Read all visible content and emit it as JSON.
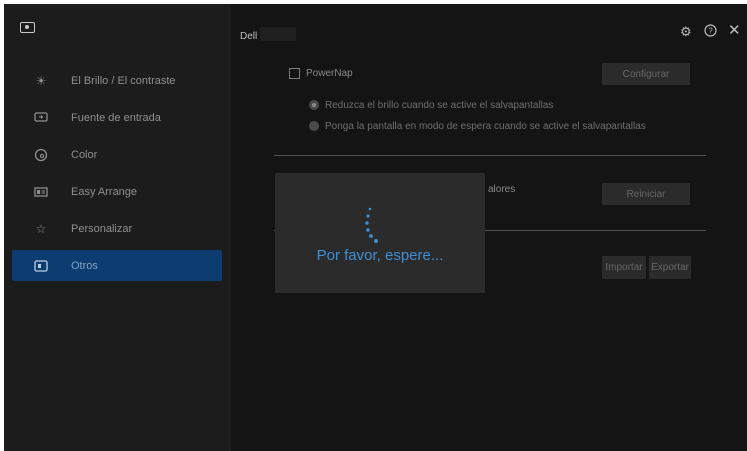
{
  "app": {
    "title": "Dell"
  },
  "sidebar": {
    "items": [
      {
        "label": "El Brillo / El contraste",
        "icon": "sun-icon"
      },
      {
        "label": "Fuente de entrada",
        "icon": "input-source-icon"
      },
      {
        "label": "Color",
        "icon": "color-palette-icon"
      },
      {
        "label": "Easy Arrange",
        "icon": "easy-arrange-icon"
      },
      {
        "label": "Personalizar",
        "icon": "star-icon"
      },
      {
        "label": "Otros",
        "icon": "others-icon",
        "active": true
      }
    ]
  },
  "header": {
    "icons": [
      "settings-gear-icon",
      "help-icon",
      "close-icon"
    ]
  },
  "powernap": {
    "checkbox_label": "PowerNap",
    "checked": false,
    "configure_button": "Configurar",
    "options": [
      {
        "label": "Reduzca el brillo cuando se active el salvapantallas",
        "selected": true
      },
      {
        "label": "Ponga la pantalla en modo de espera cuando se active el salvapantallas",
        "selected": false
      }
    ]
  },
  "reset": {
    "partial_label": "alores",
    "button": "Reiniciar"
  },
  "settings_io": {
    "import_button": "Importar",
    "export_button": "Exportar"
  },
  "loading": {
    "message": "Por favor, espere..."
  },
  "colors": {
    "accent": "#0c3c70",
    "loading_text": "#3d8fd6",
    "background": "#141414"
  }
}
